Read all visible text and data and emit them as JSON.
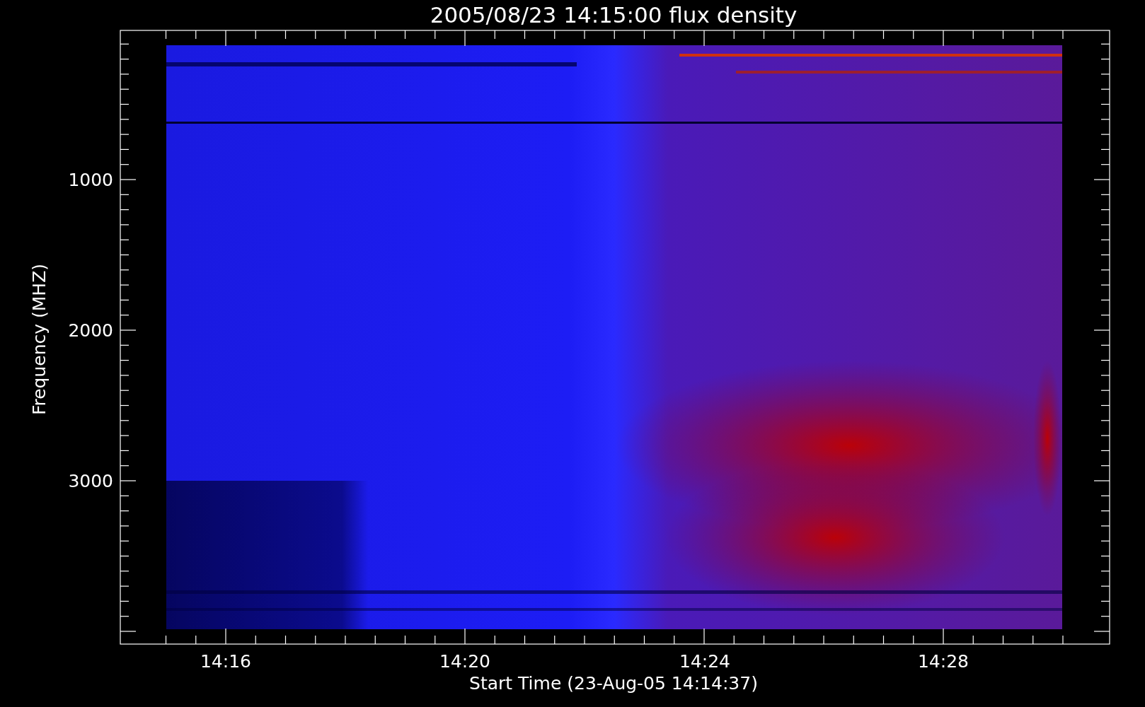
{
  "title": "2005/08/23 14:15:00 flux density",
  "plot": {
    "xlabel": "Start Time (23-Aug-05 14:14:37)",
    "ylabel": "Frequency (MHZ)",
    "xticks": [
      "14:16",
      "14:20",
      "14:24",
      "14:28"
    ],
    "yticks": [
      "1000",
      "2000",
      "3000"
    ]
  }
}
